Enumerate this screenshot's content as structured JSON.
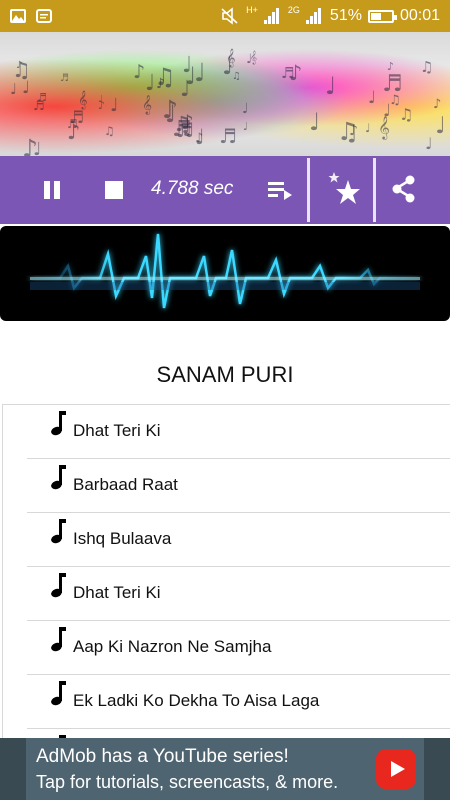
{
  "status_bar": {
    "icons_left": [
      "gallery-icon",
      "chat-icon"
    ],
    "network_label": "2G",
    "hplus_label": "H+",
    "battery_percent": "51%",
    "battery_level": 0.51,
    "time": "00:01"
  },
  "player": {
    "elapsed": "4.788 sec",
    "icons": [
      "pause-icon",
      "stop-icon",
      "queue-icon",
      "favorite-star-icon",
      "share-icon"
    ]
  },
  "artist": {
    "name": "SANAM PURI"
  },
  "songs": [
    {
      "title": "Dhat Teri Ki"
    },
    {
      "title": "Barbaad Raat"
    },
    {
      "title": "Ishq Bulaava"
    },
    {
      "title": "Dhat Teri Ki"
    },
    {
      "title": "Aap Ki Nazron Ne Samjha"
    },
    {
      "title": "Ek Ladki Ko Dekha To Aisa Laga"
    },
    {
      "title": ""
    }
  ],
  "ad": {
    "line1": "AdMob has a YouTube series!",
    "line2": "Tap for tutorials, screencasts, & more."
  },
  "colors": {
    "status_bar": "#c69a1a",
    "control_bar": "#7b56b4",
    "wave_glow": "#3ad8ff",
    "ad_bg": "#4e6470",
    "youtube_red": "#e8281f"
  }
}
